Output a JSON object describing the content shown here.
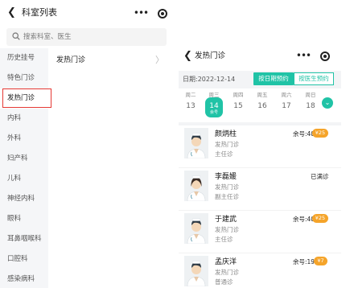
{
  "left": {
    "title": "科室列表",
    "back_glyph": "❮",
    "more_glyph": "•••",
    "search_placeholder": "搜索科室、医生",
    "departments": [
      "历史挂号",
      "特色门诊",
      "发热门诊",
      "内科",
      "外科",
      "妇产科",
      "儿科",
      "神经内科",
      "眼科",
      "耳鼻咽喉科",
      "口腔科",
      "感染病科"
    ],
    "active_index": 2,
    "sub_department": "发热门诊",
    "chevron": "〉"
  },
  "right": {
    "title": "发热门诊",
    "date_label": "日期:2022-12-14",
    "btn_by_date": "按日期预约",
    "btn_by_doctor": "按医生预约",
    "days": [
      {
        "weekday": "周二",
        "num": "13"
      },
      {
        "weekday": "周三",
        "num": "14",
        "status": "余号",
        "selected": true
      },
      {
        "weekday": "周四",
        "num": "15"
      },
      {
        "weekday": "周五",
        "num": "16"
      },
      {
        "weekday": "周六",
        "num": "17"
      },
      {
        "weekday": "周日",
        "num": "18"
      }
    ],
    "expand_glyph": "⌄",
    "doctors": [
      {
        "name": "颜炳柱",
        "dept": "发热门诊",
        "title": "主任诊",
        "remain": "余号:40",
        "price": "¥25"
      },
      {
        "name": "李磊媛",
        "dept": "发热门诊",
        "title": "副主任诊",
        "full": "已满诊"
      },
      {
        "name": "于建武",
        "dept": "发热门诊",
        "title": "主任诊",
        "remain": "余号:40",
        "price": "¥25"
      },
      {
        "name": "孟庆洋",
        "dept": "发热门诊",
        "title": "普通诊",
        "remain": "余号:19",
        "price": "¥7"
      }
    ]
  },
  "colors": {
    "accent": "#20c3a6",
    "price_badge": "#f5a42a",
    "highlight": "#e53935"
  }
}
